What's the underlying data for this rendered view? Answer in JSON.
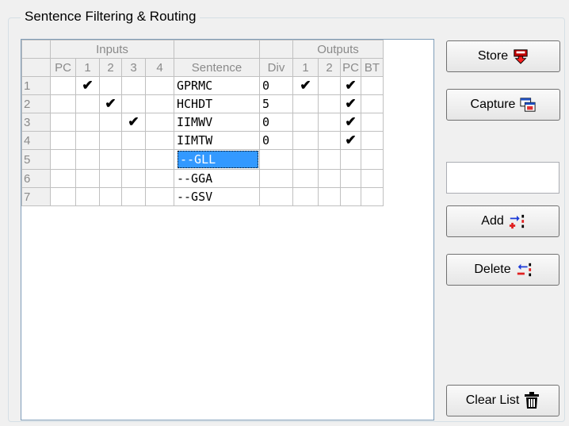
{
  "group": {
    "title": "Sentence Filtering & Routing"
  },
  "table": {
    "group_headers": {
      "inputs": "Inputs",
      "outputs": "Outputs"
    },
    "columns": [
      "PC",
      "1",
      "2",
      "3",
      "4",
      "Sentence",
      "Div",
      "1",
      "2",
      "PC",
      "BT"
    ],
    "rows": [
      {
        "num": "1",
        "in_pc": "",
        "in_1": "✔",
        "in_2": "",
        "in_3": "",
        "in_4": "",
        "sentence": "GPRMC",
        "div": "0",
        "out_1": "✔",
        "out_2": "",
        "out_pc": "✔",
        "out_bt": ""
      },
      {
        "num": "2",
        "in_pc": "",
        "in_1": "",
        "in_2": "✔",
        "in_3": "",
        "in_4": "",
        "sentence": "HCHDT",
        "div": "5",
        "out_1": "",
        "out_2": "",
        "out_pc": "✔",
        "out_bt": ""
      },
      {
        "num": "3",
        "in_pc": "",
        "in_1": "",
        "in_2": "",
        "in_3": "✔",
        "in_4": "",
        "sentence": "IIMWV",
        "div": "0",
        "out_1": "",
        "out_2": "",
        "out_pc": "✔",
        "out_bt": ""
      },
      {
        "num": "4",
        "in_pc": "",
        "in_1": "",
        "in_2": "",
        "in_3": "",
        "in_4": "",
        "sentence": "IIMTW",
        "div": "0",
        "out_1": "",
        "out_2": "",
        "out_pc": "✔",
        "out_bt": ""
      },
      {
        "num": "5",
        "in_pc": "",
        "in_1": "",
        "in_2": "",
        "in_3": "",
        "in_4": "",
        "sentence": "--GLL",
        "div": "",
        "out_1": "",
        "out_2": "",
        "out_pc": "",
        "out_bt": "",
        "selected": true
      },
      {
        "num": "6",
        "in_pc": "",
        "in_1": "",
        "in_2": "",
        "in_3": "",
        "in_4": "",
        "sentence": "--GGA",
        "div": "",
        "out_1": "",
        "out_2": "",
        "out_pc": "",
        "out_bt": ""
      },
      {
        "num": "7",
        "in_pc": "",
        "in_1": "",
        "in_2": "",
        "in_3": "",
        "in_4": "",
        "sentence": "--GSV",
        "div": "",
        "out_1": "",
        "out_2": "",
        "out_pc": "",
        "out_bt": ""
      }
    ]
  },
  "buttons": {
    "store": {
      "label": "Store",
      "icon": "store-download-icon"
    },
    "capture": {
      "label": "Capture",
      "icon": "capture-icon"
    },
    "add": {
      "label": "Add",
      "icon": "add-row-icon"
    },
    "delete": {
      "label": "Delete",
      "icon": "delete-row-icon"
    },
    "clear": {
      "label": "Clear List",
      "icon": "trash-icon"
    }
  },
  "entry": {
    "value": ""
  },
  "colors": {
    "selection": "#3399ff",
    "grid_border": "#7f9db9",
    "add_arrow": "#1e3cd8",
    "delete_arrow": "#e02020"
  }
}
